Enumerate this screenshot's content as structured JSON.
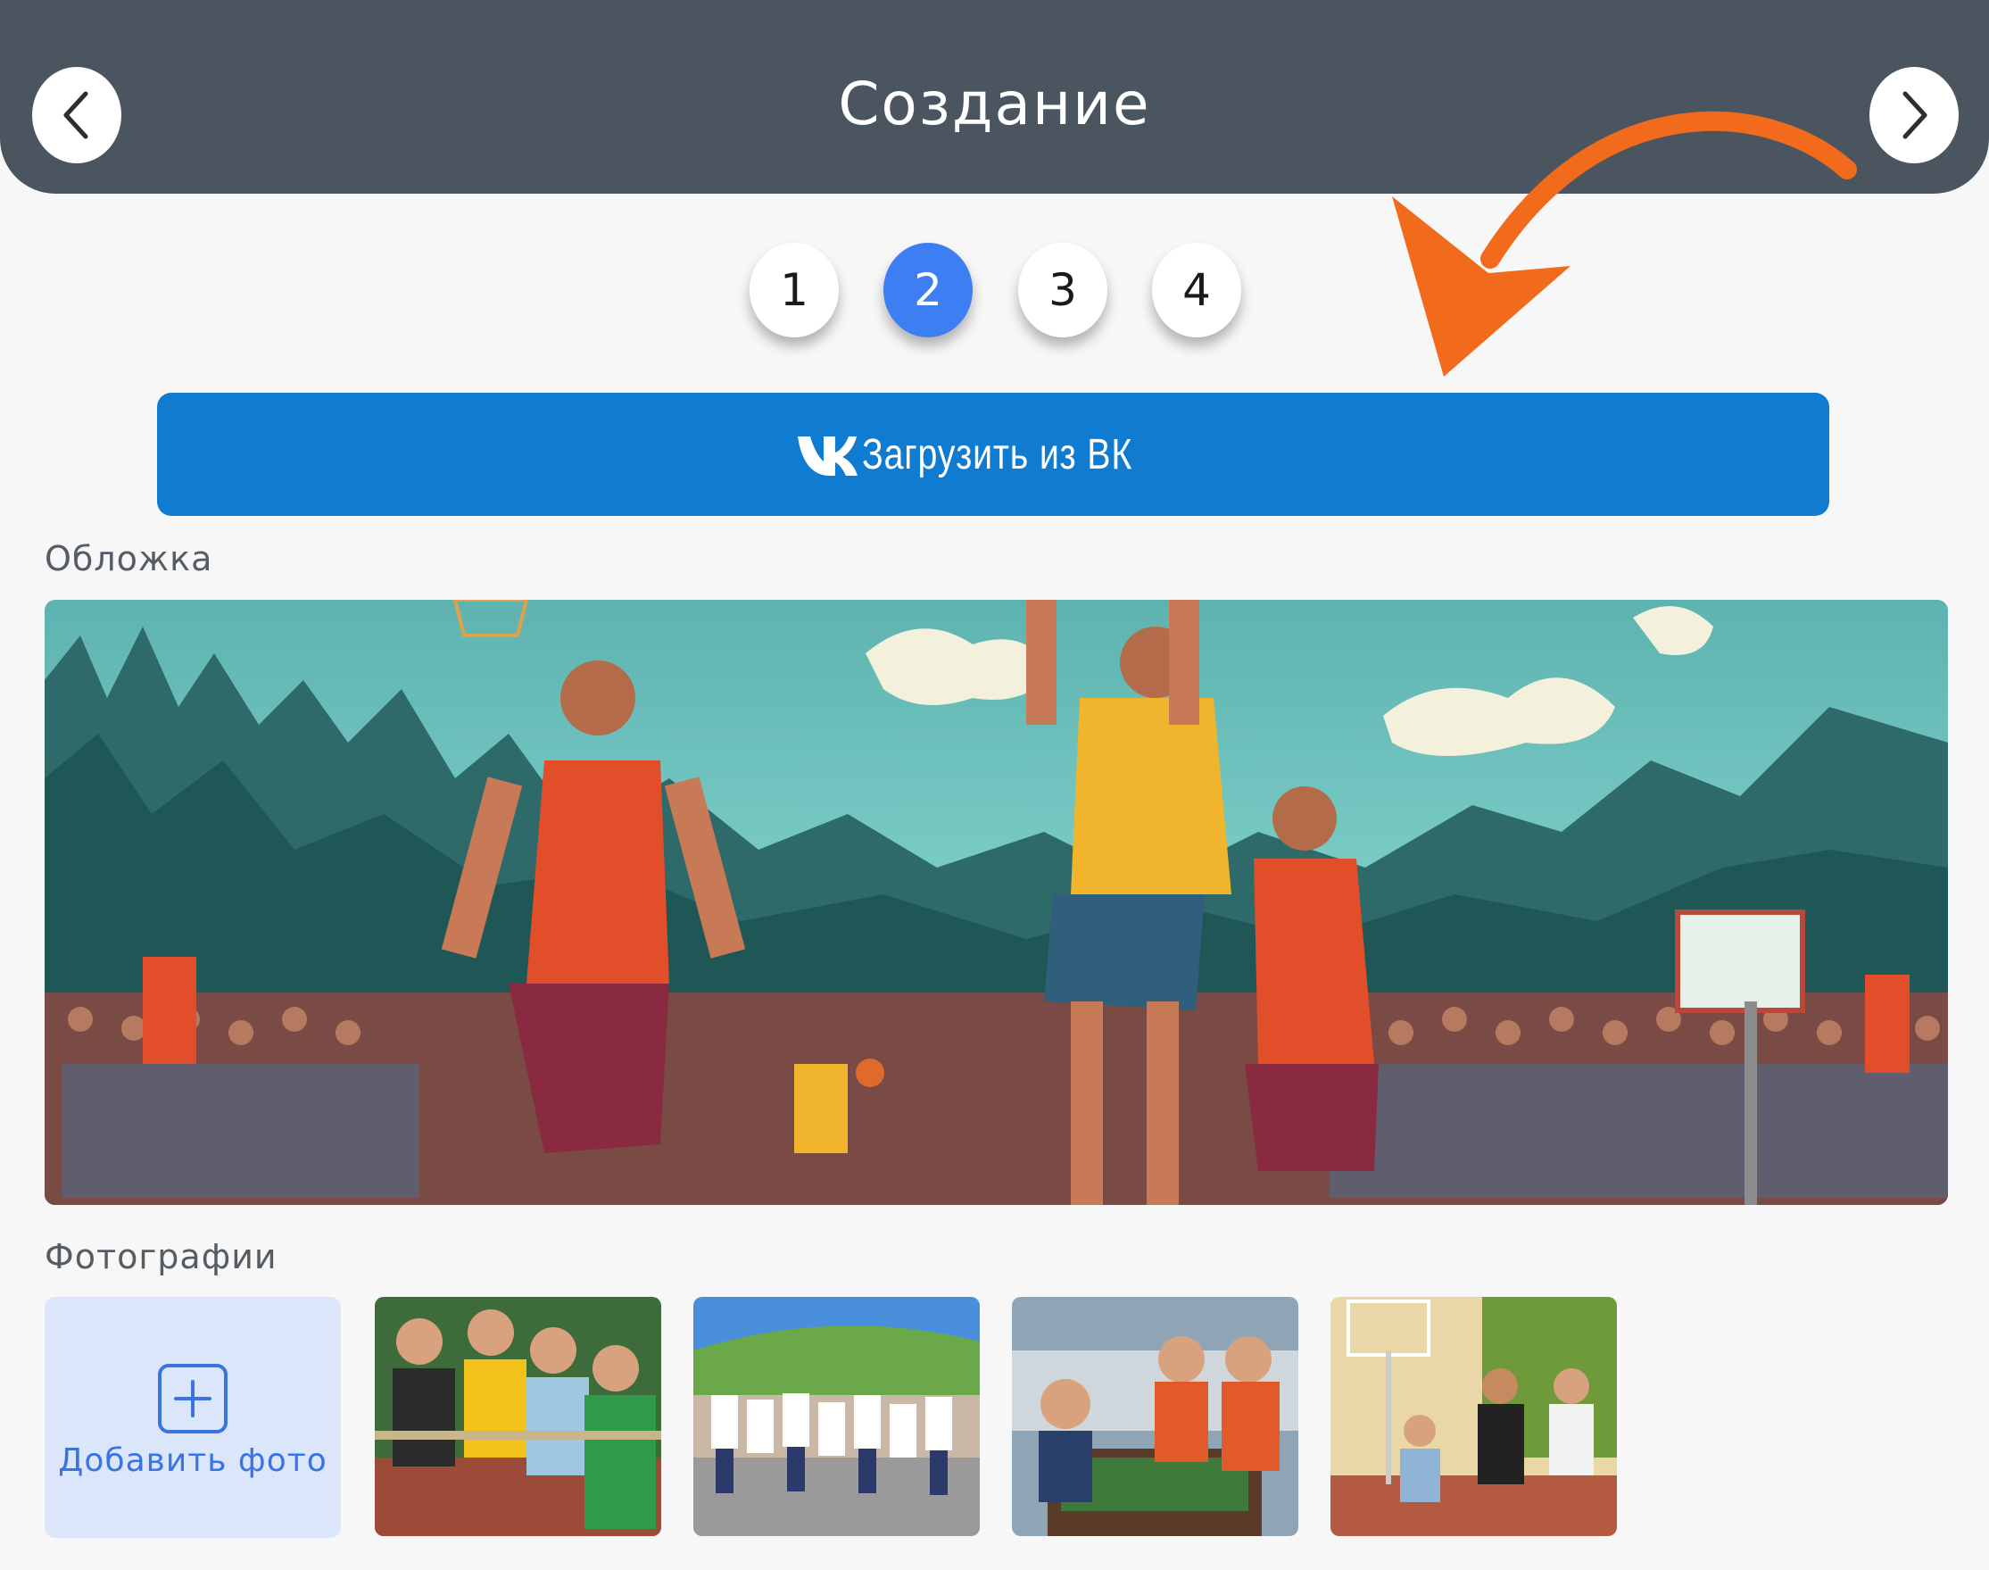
{
  "header": {
    "title": "Создание",
    "prev_icon": "chevron-left-icon",
    "next_icon": "chevron-right-icon"
  },
  "steps": [
    {
      "label": "1",
      "active": false
    },
    {
      "label": "2",
      "active": true
    },
    {
      "label": "3",
      "active": false
    },
    {
      "label": "4",
      "active": false
    }
  ],
  "vk_button": {
    "label": "Загрузить из ВК",
    "icon": "vk-logo-icon",
    "color": "#0f7bd1"
  },
  "cover": {
    "label": "Обложка",
    "image": "basketball-players-illustration"
  },
  "photos": {
    "label": "Фотографии",
    "add_label": "Добавить фото",
    "add_icon": "plus-square-icon",
    "items": [
      {
        "image": "tug-of-war-photo"
      },
      {
        "image": "running-crowd-photo"
      },
      {
        "image": "table-football-photo"
      },
      {
        "image": "street-basketball-photo"
      }
    ]
  },
  "colors": {
    "header_bg": "#4a5560",
    "active_step": "#3d7ff3",
    "annotation_arrow": "#f26a1b",
    "add_photo_bg": "#dbe6fb",
    "add_photo_text": "#3a74e0"
  }
}
